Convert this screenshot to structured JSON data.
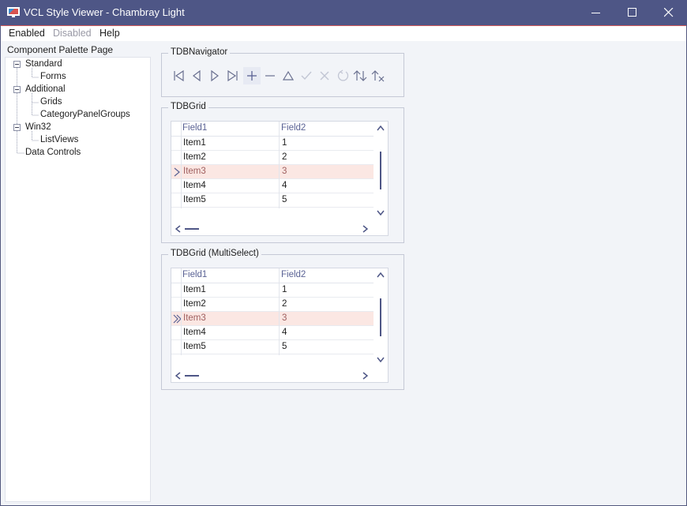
{
  "window": {
    "title": "VCL Style Viewer - Chambray Light",
    "app_icon": "monitor-icon",
    "controls": {
      "minimize": "minimize-icon",
      "maximize": "maximize-icon",
      "close": "close-icon"
    }
  },
  "menu": {
    "items": [
      "Enabled",
      "Disabled",
      "Help"
    ]
  },
  "palette": {
    "label": "Component Palette Page",
    "tree": [
      {
        "label": "Standard",
        "children": [
          "Forms"
        ]
      },
      {
        "label": "Additional",
        "children": [
          "Grids",
          "CategoryPanelGroups"
        ]
      },
      {
        "label": "Win32",
        "children": [
          "ListViews"
        ]
      },
      {
        "label": "Data Controls",
        "children": []
      }
    ]
  },
  "navigator": {
    "caption": "TDBNavigator",
    "buttons": [
      "first-icon",
      "prior-icon",
      "next-icon",
      "last-icon",
      "insert-icon",
      "delete-icon",
      "edit-icon",
      "post-icon",
      "cancel-icon",
      "refresh-icon",
      "apply-updates-icon",
      "cancel-updates-icon"
    ]
  },
  "grid1": {
    "caption": "TDBGrid",
    "columns": [
      "Field1",
      "Field2"
    ],
    "rows": [
      [
        "Item1",
        "1"
      ],
      [
        "Item2",
        "2"
      ],
      [
        "Item3",
        "3"
      ],
      [
        "Item4",
        "4"
      ],
      [
        "Item5",
        "5"
      ]
    ],
    "selected_row": 2
  },
  "grid2": {
    "caption": "TDBGrid (MultiSelect)",
    "columns": [
      "Field1",
      "Field2"
    ],
    "rows": [
      [
        "Item1",
        "1"
      ],
      [
        "Item2",
        "2"
      ],
      [
        "Item3",
        "3"
      ],
      [
        "Item4",
        "4"
      ],
      [
        "Item5",
        "5"
      ]
    ],
    "selected_row": 2
  },
  "colors": {
    "titlebar": "#4e5686",
    "accent": "#5a6294",
    "selection": "#fbe7e3",
    "menu_line": "#d25a5a"
  }
}
